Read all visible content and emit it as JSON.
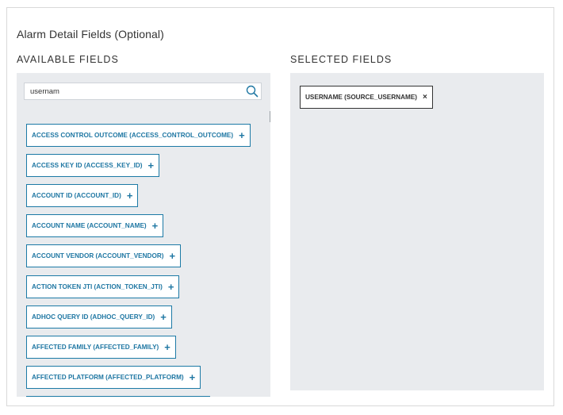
{
  "section_title": "Alarm Detail Fields (Optional)",
  "available": {
    "label": "AVAILABLE FIELDS",
    "search_value": "usernam",
    "items": [
      {
        "label": "ACCESS CONTROL OUTCOME (ACCESS_CONTROL_OUTCOME)"
      },
      {
        "label": "ACCESS KEY ID (ACCESS_KEY_ID)"
      },
      {
        "label": "ACCOUNT ID (ACCOUNT_ID)"
      },
      {
        "label": "ACCOUNT NAME (ACCOUNT_NAME)"
      },
      {
        "label": "ACCOUNT VENDOR (ACCOUNT_VENDOR)"
      },
      {
        "label": "ACTION TOKEN JTI (ACTION_TOKEN_JTI)"
      },
      {
        "label": "ADHOC QUERY ID (ADHOC_QUERY_ID)"
      },
      {
        "label": "AFFECTED FAMILY (AFFECTED_FAMILY)"
      },
      {
        "label": "AFFECTED PLATFORM (AFFECTED_PLATFORM)"
      }
    ],
    "add_symbol": "+"
  },
  "selected": {
    "label": "SELECTED FIELDS",
    "items": [
      {
        "label": "USERNAME (SOURCE_USERNAME)"
      }
    ],
    "remove_symbol": "×"
  },
  "colors": {
    "accent": "#1f77a3",
    "panel_bg": "#e9ebee"
  }
}
